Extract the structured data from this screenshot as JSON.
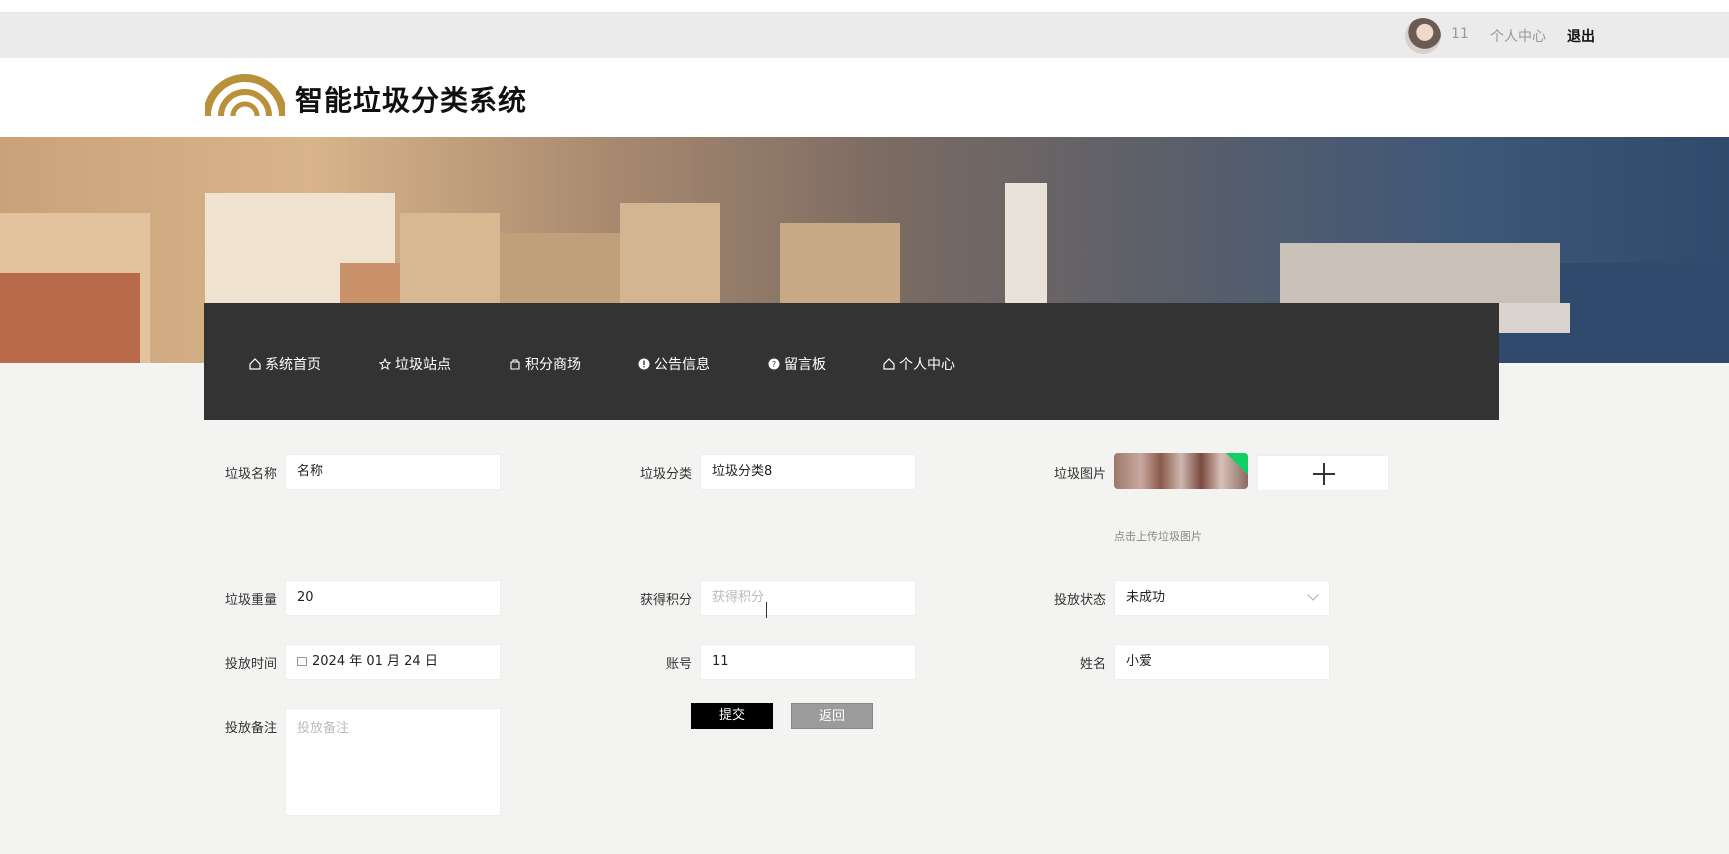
{
  "userbar": {
    "username": "11",
    "center_label": "个人中心",
    "logout_label": "退出"
  },
  "header": {
    "title": "智能垃圾分类系统",
    "logo_color": "#b8913a"
  },
  "nav": [
    {
      "label": "系统首页",
      "icon": "home-icon"
    },
    {
      "label": "垃圾站点",
      "icon": "star-icon"
    },
    {
      "label": "积分商场",
      "icon": "bag-icon"
    },
    {
      "label": "公告信息",
      "icon": "alert-icon"
    },
    {
      "label": "留言板",
      "icon": "question-icon"
    },
    {
      "label": "个人中心",
      "icon": "home-icon"
    }
  ],
  "form": {
    "name_label": "垃圾名称",
    "name_value": "名称",
    "category_label": "垃圾分类",
    "category_value": "垃圾分类8",
    "image_label": "垃圾图片",
    "image_hint": "点击上传垃圾图片",
    "weight_label": "垃圾重量",
    "weight_value": "20",
    "points_label": "获得积分",
    "points_placeholder": "获得积分",
    "status_label": "投放状态",
    "status_value": "未成功",
    "time_label": "投放时间",
    "time_value": "2024 年 01 月 24 日",
    "account_label": "账号",
    "account_value": "11",
    "realname_label": "姓名",
    "realname_value": "小爱",
    "remark_label": "投放备注",
    "remark_placeholder": "投放备注",
    "submit_label": "提交",
    "back_label": "返回"
  }
}
